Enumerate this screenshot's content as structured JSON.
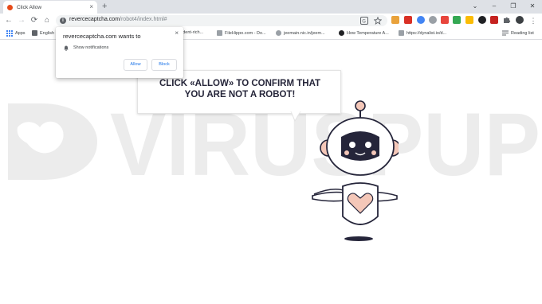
{
  "tab": {
    "title": "Click Allow",
    "close": "×",
    "new_tab": "+"
  },
  "window": {
    "minimize": "–",
    "maximize": "❐",
    "close": "✕",
    "collapse": "⌄"
  },
  "nav": {
    "back": "←",
    "forward": "→",
    "reload": "⟳",
    "home": "⌂"
  },
  "address": {
    "info_icon": "i",
    "host": "revercecaptcha.com",
    "path": "/robot4/index.html#"
  },
  "bookmarks": {
    "apps": "Apps",
    "items": [
      "English",
      "ident-rich...",
      "FileHippo.com - Do...",
      "jeemain.nic.in/jeem...",
      "How Temperature A...",
      "https://dynalist.io/d..."
    ],
    "reading_list": "Reading list"
  },
  "popup": {
    "title": "revercecaptcha.com wants to",
    "permission": "Show notifications",
    "allow": "Allow",
    "block": "Block",
    "close": "×"
  },
  "bubble": {
    "message": "CLICK «ALLOW» TO CONFIRM THAT YOU ARE NOT A ROBOT!"
  },
  "watermark": {
    "text": "VIRUSPUP"
  },
  "colors": {
    "robot_accent": "#f4c7b8",
    "robot_dark": "#25253a",
    "popup_button_text": "#1a73e8"
  }
}
